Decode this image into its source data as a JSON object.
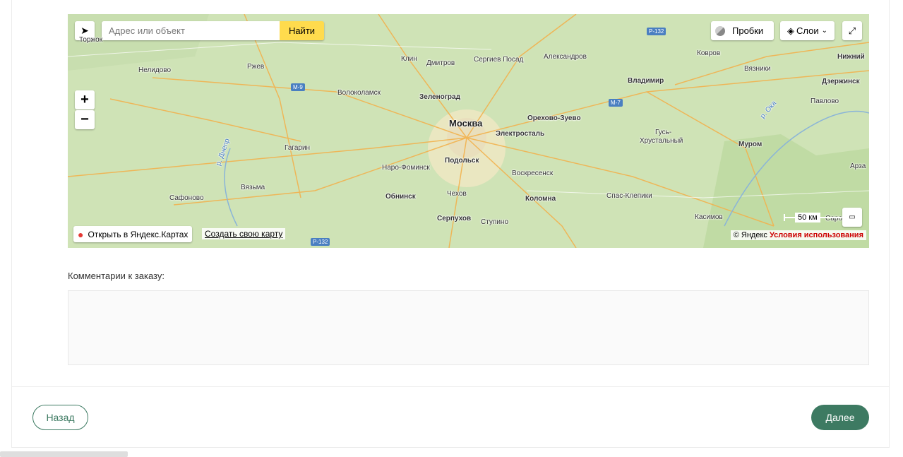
{
  "map": {
    "search": {
      "placeholder": "Адрес или объект",
      "button_label": "Найти"
    },
    "traffic_label": "Пробки",
    "layers_label": "Слои",
    "open_label": "Открыть в Яндекс.Картах",
    "create_label": "Создать свою карту",
    "copyright_prefix": "© Яндекс",
    "copyright_terms": "Условия использования",
    "scale_label": "50 км",
    "roads": [
      "Р-132",
      "М-9",
      "М-7",
      "Р-132"
    ],
    "cities": [
      {
        "name": "Торжок",
        "style": "normal"
      },
      {
        "name": "Нелидово",
        "style": "normal"
      },
      {
        "name": "Ржев",
        "style": "normal"
      },
      {
        "name": "Клин",
        "style": "normal"
      },
      {
        "name": "Дмитров",
        "style": "normal"
      },
      {
        "name": "Сергиев Посад",
        "style": "normal"
      },
      {
        "name": "Александров",
        "style": "normal"
      },
      {
        "name": "Ковров",
        "style": "normal"
      },
      {
        "name": "Нижний",
        "style": "bold"
      },
      {
        "name": "Вязники",
        "style": "normal"
      },
      {
        "name": "Волоколамск",
        "style": "normal"
      },
      {
        "name": "Зеленоград",
        "style": "bold"
      },
      {
        "name": "Владимир",
        "style": "bold"
      },
      {
        "name": "Дзержинск",
        "style": "bold"
      },
      {
        "name": "Павлово",
        "style": "normal"
      },
      {
        "name": "Орехово-Зуево",
        "style": "bold"
      },
      {
        "name": "Москва",
        "style": "big"
      },
      {
        "name": "Электросталь",
        "style": "bold"
      },
      {
        "name": "Гусь-",
        "style": "normal"
      },
      {
        "name": "Хрустальный",
        "style": "normal"
      },
      {
        "name": "Муром",
        "style": "bold"
      },
      {
        "name": "Гагарин",
        "style": "normal"
      },
      {
        "name": "Наро-Фоминск",
        "style": "normal"
      },
      {
        "name": "Подольск",
        "style": "bold"
      },
      {
        "name": "Воскресенск",
        "style": "normal"
      },
      {
        "name": "Арза",
        "style": "normal"
      },
      {
        "name": "Вязьма",
        "style": "normal"
      },
      {
        "name": "Сафоново",
        "style": "normal"
      },
      {
        "name": "Обнинск",
        "style": "bold"
      },
      {
        "name": "Чехов",
        "style": "normal"
      },
      {
        "name": "Коломна",
        "style": "bold"
      },
      {
        "name": "Спас-Клепики",
        "style": "normal"
      },
      {
        "name": "Серпухов",
        "style": "bold"
      },
      {
        "name": "Ступино",
        "style": "normal"
      },
      {
        "name": "Касимов",
        "style": "normal"
      },
      {
        "name": "Саро",
        "style": "normal"
      }
    ],
    "rivers": [
      "р. Днепр",
      "р. Ока"
    ]
  },
  "comment": {
    "label": "Комментарии к заказу:",
    "value": ""
  },
  "footer": {
    "back_label": "Назад",
    "next_label": "Далее"
  },
  "colors": {
    "accent": "#3d7a62",
    "search_button": "#ffdb4d",
    "terms": "#cc0000"
  }
}
